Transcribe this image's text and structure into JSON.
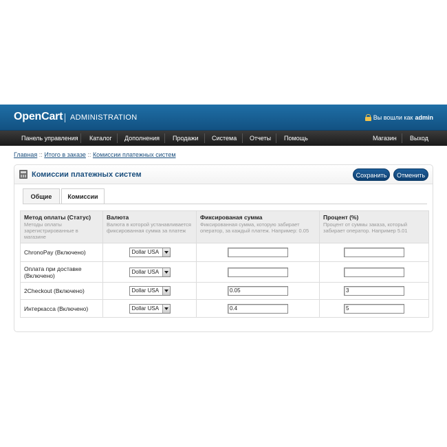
{
  "header": {
    "logo": "OpenCart",
    "subtitle": "ADMINISTRATION",
    "login_prefix": "Вы вошли как",
    "login_user": "admin"
  },
  "nav": {
    "items": [
      "Панель управления",
      "Каталог",
      "Дополнения",
      "Продажи",
      "Система",
      "Отчеты",
      "Помощь"
    ],
    "right_items": [
      "Магазин",
      "Выход"
    ]
  },
  "breadcrumb": {
    "items": [
      "Главная",
      "Итого в заказе",
      "Комиссии платежных систем"
    ],
    "separator": "::"
  },
  "box": {
    "title": "Комиссии платежных систем",
    "save_label": "Сохранить",
    "cancel_label": "Отменить"
  },
  "tabs": [
    "Общие",
    "Комиссии"
  ],
  "active_tab": "Комиссии",
  "table": {
    "headers": [
      {
        "title": "Метод оплаты (Статус)",
        "desc": "Методы оплаты зарегистрированные в магазине"
      },
      {
        "title": "Валюта",
        "desc": "Валюта в которой устанавливается фиксированная сумма за платеж"
      },
      {
        "title": "Фиксированая сумма",
        "desc": "Фиксированная сумма, которую забирает оператор, за каждый платеж. Например: 0.05"
      },
      {
        "title": "Процент (%)",
        "desc": "Процент от суммы заказа, который забирает оператор. Например 5.01"
      }
    ],
    "rows": [
      {
        "method": "ChronoPay (Включено)",
        "currency": "Dollar USA",
        "fixed": "",
        "percent": ""
      },
      {
        "method": "Оплата при доставке (Включено)",
        "currency": "Dollar USA",
        "fixed": "",
        "percent": ""
      },
      {
        "method": "2Checkout (Включено)",
        "currency": "Dollar USA",
        "fixed": "0.05",
        "percent": "3"
      },
      {
        "method": "Интеркасса (Включено)",
        "currency": "Dollar USA",
        "fixed": "0.4",
        "percent": "5"
      }
    ]
  },
  "colors": {
    "header_blue": "#1f6fa7",
    "nav_dark": "#2a2a2a",
    "link_blue": "#1a4e7d",
    "button_blue": "#1f5f9a",
    "lock_yellow": "#f0c14b"
  }
}
